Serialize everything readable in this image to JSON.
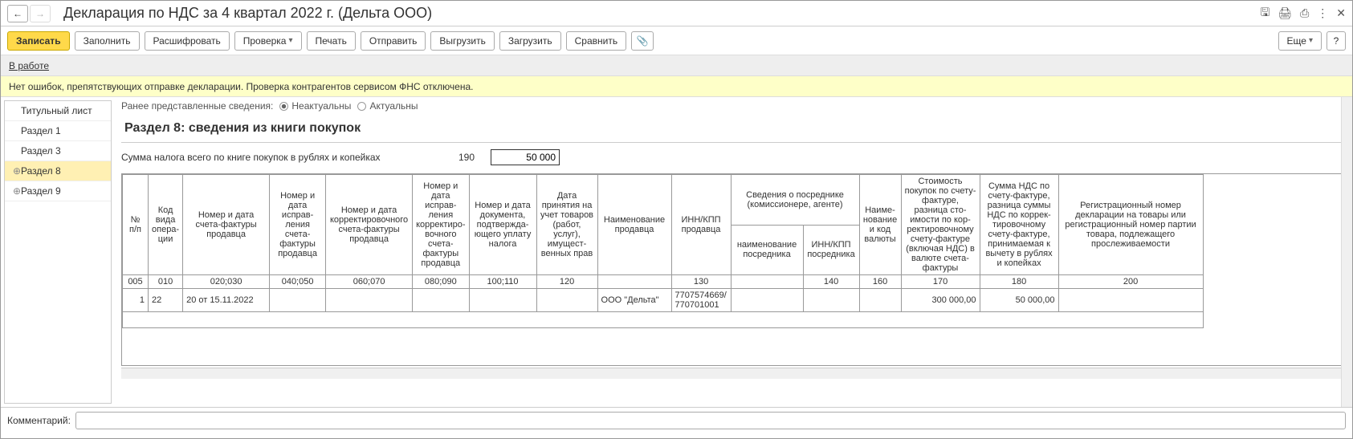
{
  "header": {
    "title": "Декларация по НДС за 4 квартал 2022 г. (Дельта ООО)"
  },
  "toolbar": {
    "write": "Записать",
    "fill": "Заполнить",
    "decode": "Расшифровать",
    "check": "Проверка",
    "print": "Печать",
    "send": "Отправить",
    "upload": "Выгрузить",
    "download": "Загрузить",
    "compare": "Сравнить",
    "more": "Еще",
    "help": "?"
  },
  "status": "В работе",
  "info": "Нет ошибок, препятствующих отправке декларации. Проверка контрагентов сервисом ФНС отключена.",
  "sidebar": {
    "items": [
      {
        "label": "Титульный лист",
        "marker": ""
      },
      {
        "label": "Раздел 1",
        "marker": ""
      },
      {
        "label": "Раздел 3",
        "marker": ""
      },
      {
        "label": "Раздел 8",
        "marker": "⊕"
      },
      {
        "label": "Раздел 9",
        "marker": "⊕"
      }
    ]
  },
  "radio": {
    "prefix": "Ранее представленные сведения:",
    "opt1": "Неактуальны",
    "opt2": "Актуальны"
  },
  "section": {
    "title": "Раздел 8: сведения из книги покупок"
  },
  "sum": {
    "label": "Сумма налога всего по книге покупок в рублях и копейках",
    "code": "190",
    "value": "50 000"
  },
  "table": {
    "headers": {
      "h1": "№ п/п",
      "h2": "Код вида опера-ции",
      "h3": "Номер и дата счета-фактуры продавца",
      "h4": "Номер и дата исправ-ления счета-фактуры продавца",
      "h5": "Номер и дата корректировочного счета-фактуры продавца",
      "h6": "Номер и дата исправ-ления корректиро-вочного счета-фактуры продавца",
      "h7": "Номер и дата документа, подтвержда-ющего уплату налога",
      "h8": "Дата принятия на учет товаров (работ, услуг), имущест-венных прав",
      "h9": "Наименование продавца",
      "h10": "ИНН/КПП продавца",
      "h11": "Сведения о посреднике (комиссионере, агенте)",
      "h11a": "наименование посредника",
      "h11b": "ИНН/КПП посредника",
      "h12": "Наиме-нование и код валюты",
      "h13": "Стоимость покупок по счету-фактуре, разница сто-имости по кор-ректировочному счету-фактуре (включая НДС) в валюте счета-фактуры",
      "h14": "Сумма НДС по счету-фактуре, разница суммы НДС по коррек-тировочному счету-фактуре, принимаемая к вычету в рублях и копейках",
      "h15": "Регистрационный номер декларации на товары или регистрационный номер партии товара, подлежащего прослеживаемости"
    },
    "codes": {
      "c1": "005",
      "c2": "010",
      "c3": "020;030",
      "c4": "040;050",
      "c5": "060;070",
      "c6": "080;090",
      "c7": "100;110",
      "c8": "120",
      "c10": "130",
      "c11b": "140",
      "c12": "160",
      "c13": "170",
      "c14": "180",
      "c15": "200"
    },
    "row": {
      "r1": "1",
      "r2": "22",
      "r3": "20 от 15.11.2022",
      "r9": "ООО \"Дельта\"",
      "r10a": "7707574669/",
      "r10b": "770701001",
      "r13": "300 000,00",
      "r14": "50 000,00"
    }
  },
  "footer": {
    "label": "Комментарий:"
  }
}
